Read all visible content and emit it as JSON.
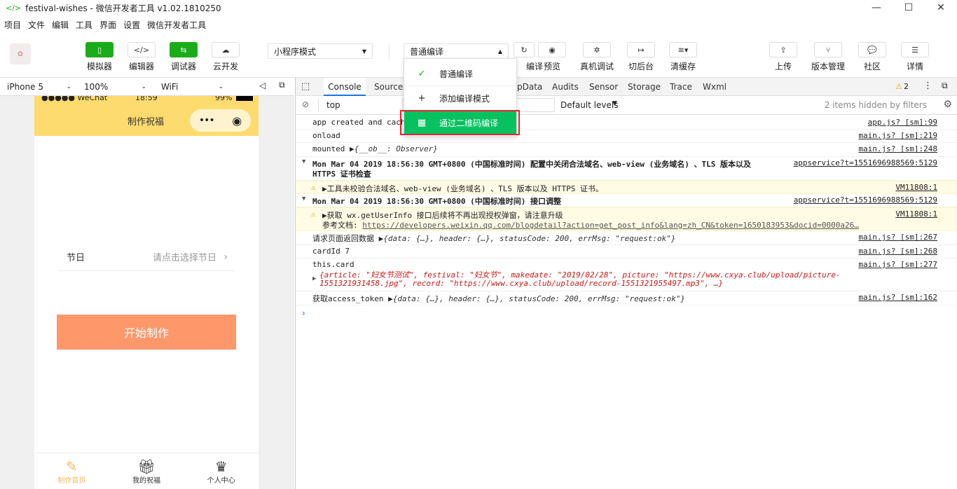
{
  "window": {
    "title": "festival-wishes - 微信开发者工具 v1.02.1810250"
  },
  "menu": [
    "项目",
    "文件",
    "编辑",
    "工具",
    "界面",
    "设置",
    "微信开发者工具"
  ],
  "toolbar": {
    "simulator": "模拟器",
    "editor": "编辑器",
    "debugger": "调试器",
    "cloud": "云开发",
    "mode": "小程序模式",
    "compile": "普通编译",
    "compile_btn_tail": "编译",
    "preview": "预览",
    "remote_debug": "真机调试",
    "background": "切后台",
    "clear_cache": "清缓存",
    "upload": "上传",
    "version": "版本管理",
    "community": "社区",
    "details": "详情"
  },
  "device": {
    "model": "iPhone 5",
    "zoom": "100%",
    "network": "WiFi"
  },
  "phone": {
    "carrier": "●●●●● WeChat",
    "time": "18:59",
    "battery": "99%",
    "nav_title": "制作祝福",
    "festival_label": "节日",
    "festival_placeholder": "请点击选择节日",
    "start_button": "开始制作",
    "tabs": [
      "制作首页",
      "我的祝福",
      "个人中心"
    ]
  },
  "devtools": {
    "tabs": [
      "Console",
      "Sources",
      "AppData",
      "Audits",
      "Sensor",
      "Storage",
      "Trace",
      "Wxml"
    ],
    "tab_appdata_visible": "pData",
    "warning_count": "2",
    "context": "top",
    "levels": "Default levels",
    "hidden": "2 items hidden by filters"
  },
  "console": {
    "r1_msg": "app created and cach",
    "r1_src": "app.js? [sm]:99",
    "r2_msg": "onload",
    "r2_src": "main.js? [sm]:219",
    "r3_msg": "mounted",
    "r3_obj": "{__ob__: Observer}",
    "r3_src": "main.js? [sm]:248",
    "r4_msg": "Mon Mar 04 2019 18:56:30 GMT+0800 (中国标准时间) 配置中关闭合法域名、web-view (业务域名) 、TLS 版本以及",
    "r4_msg2": "HTTPS 证书检查",
    "r4_src": "appservice?t=1551696988569:5129",
    "r5_msg": "▶工具未校验合法域名、web-view (业务域名) 、TLS 版本以及 HTTPS 证书。",
    "r5_src": "VM11808:1",
    "r6_msg": "Mon Mar 04 2019 18:56:30 GMT+0800 (中国标准时间) 接口调整",
    "r6_src": "appservice?t=1551696988569:5129",
    "r7_msg": "▶获取 wx.getUserInfo 接口后续将不再出现授权弹窗，请注意升级",
    "r7_msg2": "参考文档: ",
    "r7_link": "https://developers.weixin.qq.com/blogdetail?action=get_post_info&lang=zh_CN&token=1650183953&docid=0000a26…",
    "r7_src": "VM11808:1",
    "r8_msg": "请求页面返回数据",
    "r8_obj": "{data: {…}, header: {…}, statusCode: 200, errMsg: \"request:ok\"}",
    "r8_src": "main.js? [sm]:267",
    "r9_msg": "cardId 7",
    "r9_src": "main.js? [sm]:268",
    "r10_msg": "this.card",
    "r10_obj1": "{article: \"妇女节测试\", festival: \"妇女节\", makedate: \"2019/02/28\", picture: \"https://www.cxya.club/upload/picture-",
    "r10_obj2": "1551321931458.jpg\", record: \"https://www.cxya.club/upload/record-1551321955497.mp3\", …}",
    "r10_src": "main.js? [sm]:277",
    "r11_msg": "获取access_token",
    "r11_obj": "{data: {…}, header: {…}, statusCode: 200, errMsg: \"request:ok\"}",
    "r11_src": "main.js? [sm]:162"
  },
  "dropdown": {
    "items": [
      "普通编译",
      "添加编译模式",
      "通过二维码编译"
    ]
  }
}
